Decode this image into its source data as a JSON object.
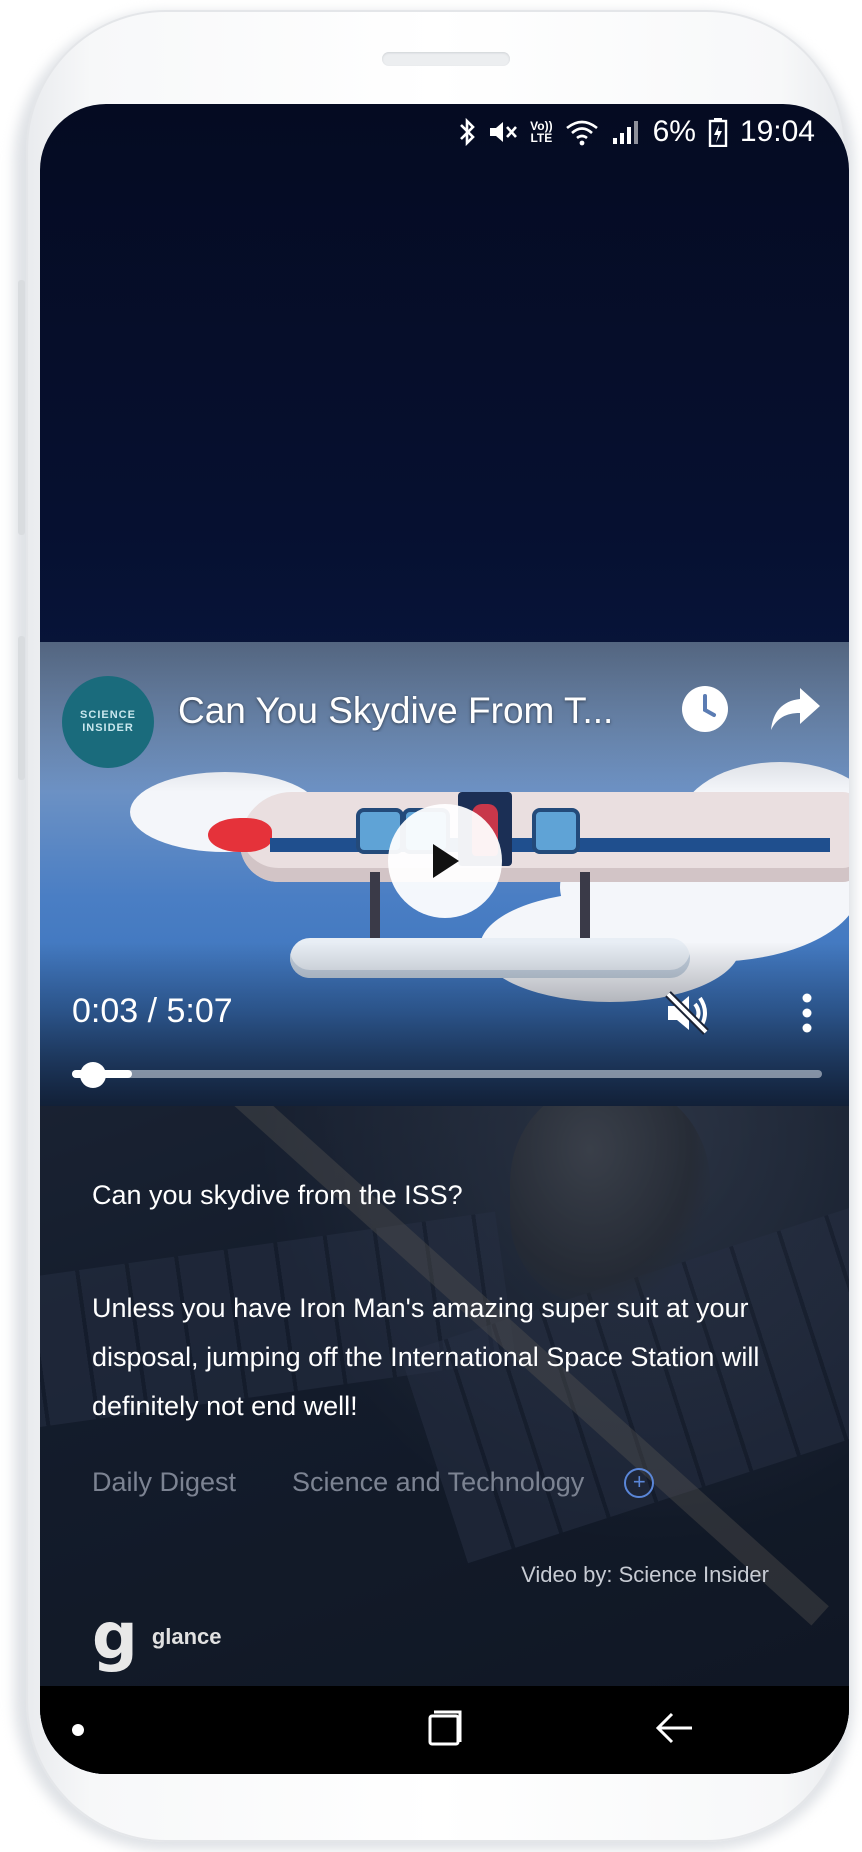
{
  "status_bar": {
    "battery": "6%",
    "time": "19:04",
    "volte_top": "Vo))",
    "volte_bottom": "LTE",
    "icons": [
      "bluetooth-icon",
      "mute-icon",
      "volte-icon",
      "wifi-icon",
      "signal-icon",
      "battery-icon"
    ]
  },
  "video": {
    "channel_logo_line1": "SCIENCE",
    "channel_logo_line2": "INSIDER",
    "title": "Can You Skydive From T...",
    "time_display": "0:03 / 5:07",
    "progress": 0.01,
    "icons": [
      "watch-later-icon",
      "share-icon",
      "play-icon",
      "volume-off-icon",
      "more-vert-icon"
    ]
  },
  "story": {
    "headline": "Can you skydive from the ISS?",
    "body": "Unless you have Iron Man's amazing super suit at your disposal, jumping off the International Space Station will definitely not end well!",
    "tags": [
      "Daily Digest",
      "Science and Technology"
    ],
    "credit": "Video by: Science Insider"
  },
  "brand": {
    "logo_letter": "g",
    "name": "glance"
  },
  "colors": {
    "accent": "#5a86d8",
    "tag_text": "#7c8392",
    "channel_logo": "#1a6b7c"
  }
}
